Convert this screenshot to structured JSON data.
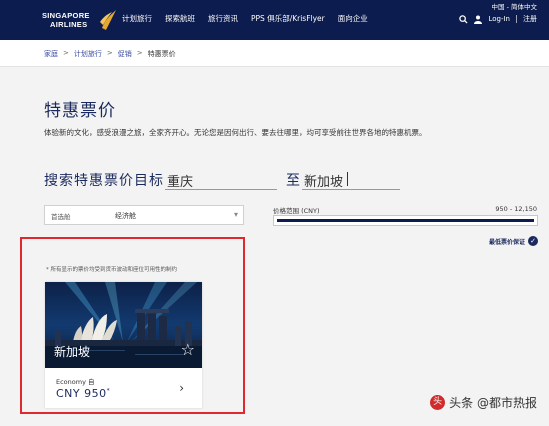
{
  "header": {
    "logo_line1": "SINGAPORE",
    "logo_line2": "AIRLINES",
    "nav": [
      "计划旅行",
      "探索航班",
      "旅行资讯",
      "PPS 俱乐部/KrisFlyer",
      "面向企业"
    ],
    "language": "中国 - 简体中文",
    "login": "Log-In",
    "register": "注册",
    "bg_color": "#0d1c4f"
  },
  "breadcrumb": {
    "items": [
      "家庭",
      "计划旅行",
      "促销"
    ],
    "current": "特惠票价",
    "separator": ">"
  },
  "page": {
    "title": "特惠票价",
    "description": "体验新的文化，感受浪漫之旅，全家齐开心。无论您是因何出行、要去往哪里，均可享受前往世界各地的特惠机票。"
  },
  "search": {
    "label": "搜索特惠票价目标",
    "from_value": "重庆",
    "to_label": "至",
    "to_value": "新加坡"
  },
  "cabin": {
    "label": "首选舱",
    "value": "经济舱"
  },
  "price_filter": {
    "label": "价格范围 (CNY)",
    "range": "950 - 12,150",
    "fill_fraction": 1.0
  },
  "best_price_label": "最低票价保证",
  "disclaimer": "* 所有显示的票价均受到货币波动和座位可用性的制约",
  "card": {
    "city": "新加坡",
    "cabin_class": "Economy 自",
    "price": "CNY 950",
    "price_mark": "*"
  },
  "watermark": {
    "text": "头条 @都市热报"
  },
  "colors": {
    "accent": "#1b2a5e",
    "highlight_box": "#e0292e"
  }
}
